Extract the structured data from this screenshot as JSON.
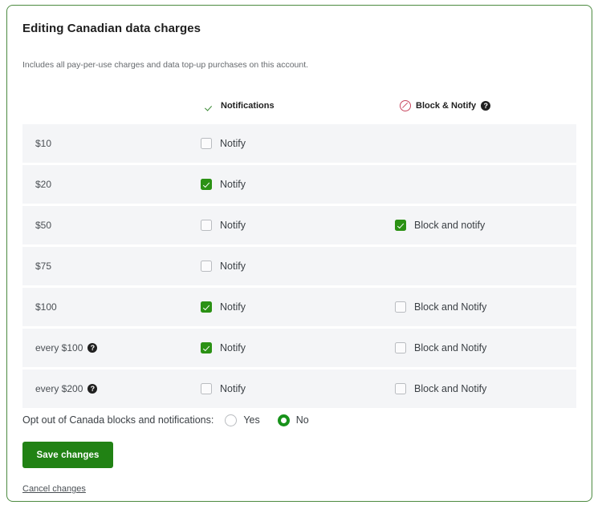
{
  "card": {
    "title": "Editing Canadian data charges",
    "description": "Includes all pay-per-use charges and data top-up purchases on this account.",
    "border_color": "#4c8a40"
  },
  "columns": {
    "notifications": {
      "label": "Notifications",
      "icon": "check-icon",
      "icon_color": "#3a8a34"
    },
    "block_notify": {
      "label": "Block & Notify",
      "icon": "block-slash-icon",
      "icon_color": "#c8475f",
      "help_icon": "help-icon",
      "help_glyph": "?"
    }
  },
  "rows": [
    {
      "amount": "$10",
      "has_help": false,
      "notify": {
        "label": "Notify",
        "checked": false,
        "visible": true
      },
      "block": {
        "label": "",
        "checked": false,
        "visible": false
      }
    },
    {
      "amount": "$20",
      "has_help": false,
      "notify": {
        "label": "Notify",
        "checked": true,
        "visible": true
      },
      "block": {
        "label": "",
        "checked": false,
        "visible": false
      }
    },
    {
      "amount": "$50",
      "has_help": false,
      "notify": {
        "label": "Notify",
        "checked": false,
        "visible": true
      },
      "block": {
        "label": "Block and notify",
        "checked": true,
        "visible": true
      }
    },
    {
      "amount": "$75",
      "has_help": false,
      "notify": {
        "label": "Notify",
        "checked": false,
        "visible": true
      },
      "block": {
        "label": "",
        "checked": false,
        "visible": false
      }
    },
    {
      "amount": "$100",
      "has_help": false,
      "notify": {
        "label": "Notify",
        "checked": true,
        "visible": true
      },
      "block": {
        "label": "Block and Notify",
        "checked": false,
        "visible": true
      }
    },
    {
      "amount": "every $100",
      "has_help": true,
      "help_glyph": "?",
      "notify": {
        "label": "Notify",
        "checked": true,
        "visible": true
      },
      "block": {
        "label": "Block and Notify",
        "checked": false,
        "visible": true
      }
    },
    {
      "amount": "every $200",
      "has_help": true,
      "help_glyph": "?",
      "notify": {
        "label": "Notify",
        "checked": false,
        "visible": true
      },
      "block": {
        "label": "Block and Notify",
        "checked": false,
        "visible": true
      }
    }
  ],
  "optout": {
    "label": "Opt out of Canada blocks and notifications:",
    "options": [
      {
        "label": "Yes",
        "selected": false
      },
      {
        "label": "No",
        "selected": true
      }
    ]
  },
  "actions": {
    "save_label": "Save changes",
    "save_color": "#218214",
    "cancel_label": "Cancel changes"
  }
}
